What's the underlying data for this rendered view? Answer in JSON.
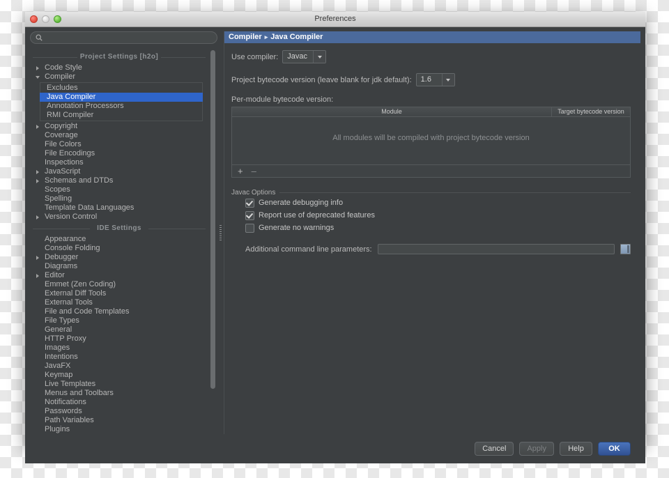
{
  "window": {
    "title": "Preferences",
    "traffic_lights": [
      "close-button",
      "minimize-button",
      "zoom-button"
    ]
  },
  "sidebar": {
    "search": {
      "value": "",
      "placeholder": ""
    },
    "groups": [
      {
        "header": "Project Settings [h2o]",
        "items": [
          {
            "label": "Code Style",
            "arrow": "right"
          },
          {
            "label": "Compiler",
            "arrow": "down"
          },
          {
            "label": "Excludes",
            "arrow": "none",
            "sub": true
          },
          {
            "label": "Java Compiler",
            "arrow": "none",
            "sub": true,
            "selected": true
          },
          {
            "label": "Annotation Processors",
            "arrow": "none",
            "sub": true
          },
          {
            "label": "RMI Compiler",
            "arrow": "none",
            "sub": true
          },
          {
            "label": "Copyright",
            "arrow": "right"
          },
          {
            "label": "Coverage",
            "arrow": "none"
          },
          {
            "label": "File Colors",
            "arrow": "none"
          },
          {
            "label": "File Encodings",
            "arrow": "none"
          },
          {
            "label": "Inspections",
            "arrow": "none"
          },
          {
            "label": "JavaScript",
            "arrow": "right"
          },
          {
            "label": "Schemas and DTDs",
            "arrow": "right"
          },
          {
            "label": "Scopes",
            "arrow": "none"
          },
          {
            "label": "Spelling",
            "arrow": "none"
          },
          {
            "label": "Template Data Languages",
            "arrow": "none"
          },
          {
            "label": "Version Control",
            "arrow": "right"
          }
        ]
      },
      {
        "header": "IDE Settings",
        "items": [
          {
            "label": "Appearance",
            "arrow": "none"
          },
          {
            "label": "Console Folding",
            "arrow": "none"
          },
          {
            "label": "Debugger",
            "arrow": "right"
          },
          {
            "label": "Diagrams",
            "arrow": "none"
          },
          {
            "label": "Editor",
            "arrow": "right"
          },
          {
            "label": "Emmet (Zen Coding)",
            "arrow": "none"
          },
          {
            "label": "External Diff Tools",
            "arrow": "none"
          },
          {
            "label": "External Tools",
            "arrow": "none"
          },
          {
            "label": "File and Code Templates",
            "arrow": "none"
          },
          {
            "label": "File Types",
            "arrow": "none"
          },
          {
            "label": "General",
            "arrow": "none"
          },
          {
            "label": "HTTP Proxy",
            "arrow": "none"
          },
          {
            "label": "Images",
            "arrow": "none"
          },
          {
            "label": "Intentions",
            "arrow": "none"
          },
          {
            "label": "JavaFX",
            "arrow": "none"
          },
          {
            "label": "Keymap",
            "arrow": "none"
          },
          {
            "label": "Live Templates",
            "arrow": "none"
          },
          {
            "label": "Menus and Toolbars",
            "arrow": "none"
          },
          {
            "label": "Notifications",
            "arrow": "none"
          },
          {
            "label": "Passwords",
            "arrow": "none"
          },
          {
            "label": "Path Variables",
            "arrow": "none"
          },
          {
            "label": "Plugins",
            "arrow": "none"
          }
        ]
      }
    ]
  },
  "main": {
    "breadcrumb": {
      "parent": "Compiler",
      "separator": "▸",
      "current": "Java Compiler"
    },
    "use_compiler": {
      "label": "Use compiler:",
      "value": "Javac"
    },
    "project_bytecode": {
      "label": "Project bytecode version (leave blank for jdk default):",
      "value": "1.6"
    },
    "per_module": {
      "label": "Per-module bytecode version:",
      "columns": [
        "Module",
        "Target bytecode version"
      ],
      "empty_message": "All modules will be compiled with project bytecode version",
      "rows": [],
      "toolbar": {
        "add": "+",
        "remove": "–"
      }
    },
    "javac_options": {
      "section_label": "Javac Options",
      "checkboxes": [
        {
          "label": "Generate debugging info",
          "checked": true
        },
        {
          "label": "Report use of deprecated features",
          "checked": true
        },
        {
          "label": "Generate no warnings",
          "checked": false
        }
      ],
      "additional_params": {
        "label": "Additional command line parameters:",
        "value": "",
        "placeholder": ""
      }
    }
  },
  "footer": {
    "cancel": "Cancel",
    "apply": "Apply",
    "help": "Help",
    "ok": "OK"
  },
  "colors": {
    "accent_selection": "#2f65ca",
    "panel_title_bg": "#4b6a9c",
    "window_bg": "#3c3f41",
    "primary_button": "#3a5da3"
  }
}
